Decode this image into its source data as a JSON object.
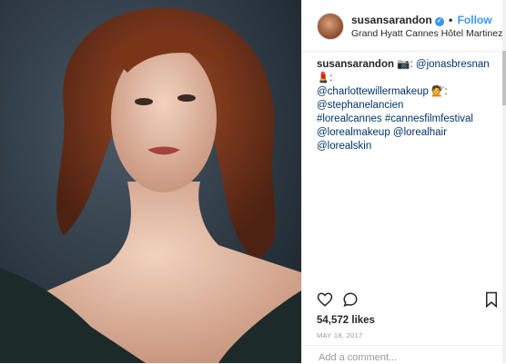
{
  "post": {
    "username": "susansarandon",
    "verified_icon": "verified-badge-icon",
    "separator": "•",
    "follow_label": "Follow",
    "location": "Grand Hyatt Cannes Hôtel Martinez",
    "caption": {
      "author": "susansarandon",
      "camera_emoji": "📷",
      "mention_photographer": "@jonasbresnan",
      "makeup_emoji": "💄",
      "colon1": ":",
      "mention_makeup": "@charlottewillermakeup",
      "hair_emoji": "💇",
      "colon2": ":",
      "mention_hair": "@stephanelancien",
      "hashtag1": "#lorealcannes",
      "hashtag2": "#cannesfilmfestival",
      "mention_loreal_makeup": "@lorealmakeup",
      "mention_loreal_hair": "@lorealhair",
      "mention_loreal_skin": "@lorealskin"
    },
    "likes": "54,572 likes",
    "date": "MAY 18, 2017",
    "comment_placeholder": "Add a comment..."
  }
}
